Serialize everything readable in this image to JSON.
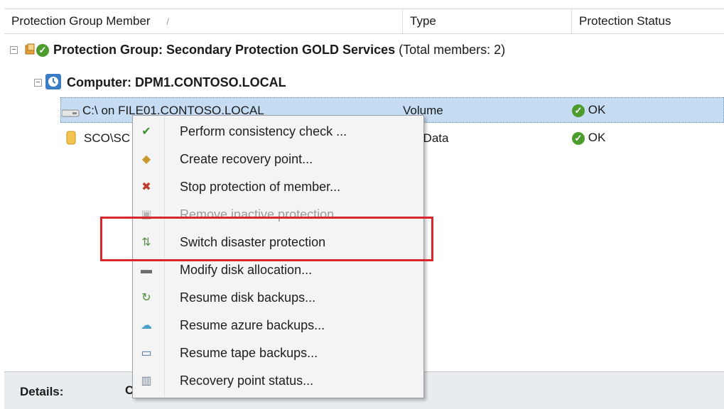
{
  "columns": {
    "member": "Protection Group Member",
    "sort_glyph": "/",
    "type": "Type",
    "status": "Protection Status"
  },
  "group": {
    "expander": "⊟",
    "title": "Protection Group: Secondary Protection GOLD Services",
    "count": "(Total members: 2)"
  },
  "computer": {
    "expander": "⊟",
    "title": "Computer: DPM1.CONTOSO.LOCAL"
  },
  "rows": [
    {
      "name": "C:\\ on FILE01.CONTOSO.LOCAL",
      "type": "Volume",
      "status": "OK",
      "selected": true
    },
    {
      "name": "SCO\\SC",
      "type": "L Data",
      "status": "OK",
      "selected": false
    }
  ],
  "context_menu": {
    "items": [
      {
        "label": "Perform consistency check ...",
        "icon": "consistency-check-icon",
        "glyph": "✔",
        "color": "#3b8f2f",
        "enabled": true
      },
      {
        "label": "Create recovery point...",
        "icon": "recovery-point-icon",
        "glyph": "◆",
        "color": "#c99a2e",
        "enabled": true
      },
      {
        "label": "Stop protection of member...",
        "icon": "stop-protection-icon",
        "glyph": "✖",
        "color": "#c0392b",
        "enabled": true
      },
      {
        "label": "Remove inactive protection...",
        "icon": "remove-protection-icon",
        "glyph": "▣",
        "color": "#b5b5b5",
        "enabled": false
      },
      {
        "label": "Switch disaster protection",
        "icon": "switch-protection-icon",
        "glyph": "⇅",
        "color": "#5a8f4a",
        "enabled": true
      },
      {
        "label": "Modify disk allocation...",
        "icon": "disk-allocation-icon",
        "glyph": "▬",
        "color": "#6d6d6d",
        "enabled": true
      },
      {
        "label": "Resume disk backups...",
        "icon": "resume-disk-icon",
        "glyph": "↻",
        "color": "#4c8b3a",
        "enabled": true
      },
      {
        "label": "Resume azure backups...",
        "icon": "resume-azure-icon",
        "glyph": "☁",
        "color": "#4aa0c8",
        "enabled": true
      },
      {
        "label": "Resume tape backups...",
        "icon": "resume-tape-icon",
        "glyph": "▭",
        "color": "#3f6f8f",
        "enabled": true
      },
      {
        "label": "Recovery point status...",
        "icon": "recovery-status-icon",
        "glyph": "▥",
        "color": "#7a8a9a",
        "enabled": true
      }
    ]
  },
  "details": {
    "label": "Details:",
    "value": "C"
  },
  "colors": {
    "selection": "#c6dcf3",
    "highlight_box": "#d9262c",
    "ok_green": "#4e9b2e"
  }
}
